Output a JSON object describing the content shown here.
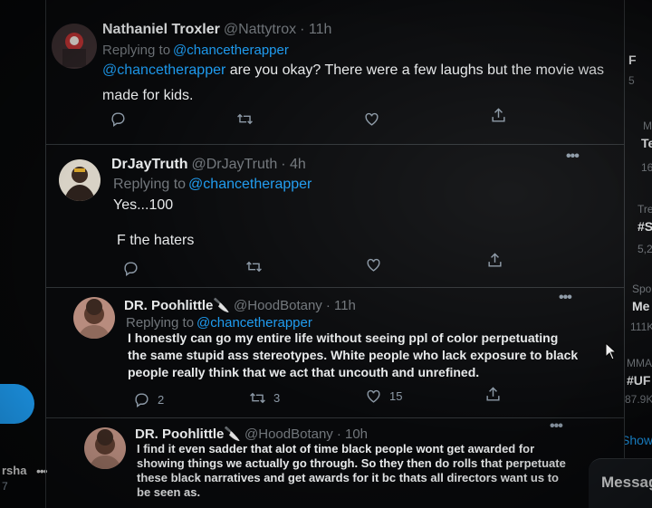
{
  "left_rail": {
    "account_name": "rsha",
    "account_sub": "7",
    "more": "•••"
  },
  "tweets": [
    {
      "display_name": "Nathaniel Troxler",
      "handle": "@Nattytrox",
      "time": "· 11h",
      "replying_to_label": "Replying to",
      "replying_to": "@chancetherapper",
      "mention": "@chancetherapper",
      "text": " are you okay? There were a few laughs but the movie was made for kids.",
      "reply_count": "",
      "retweet_count": "",
      "like_count": ""
    },
    {
      "display_name": "DrJayTruth",
      "handle": "@DrJayTruth",
      "time": "· 4h",
      "replying_to_label": "Replying to",
      "replying_to": "@chancetherapper",
      "text_1": "Yes...100",
      "text_2": "F the haters",
      "more": "•••"
    },
    {
      "display_name": "DR. Poohlittle🔪",
      "handle": "@HoodBotany",
      "time": "· 11h",
      "replying_to_label": "Replying to",
      "replying_to": "@chancetherapper",
      "text": "I honestly can go my entire life without seeing ppl of color perpetuating the same stupid ass stereotypes. White people who lack exposure to black people really think that we act that uncouth and unrefined.",
      "reply_count": "2",
      "retweet_count": "3",
      "like_count": "15",
      "more": "•••"
    },
    {
      "display_name": "DR. Poohlittle🔪",
      "handle": "@HoodBotany",
      "time": "· 10h",
      "text": "I find it even sadder that alot of time black people wont get  awarded for showing things we actually go through. So they then do rolls that perpetuate these black narratives and get awards for it bc thats all directors want us to be seen as.",
      "more": "•••"
    }
  ],
  "sidebar": {
    "items": [
      "F",
      "5",
      "M",
      "Te",
      "16",
      "Tre",
      "#S",
      "5,2",
      "Spo",
      "Me",
      "111K",
      "MMA",
      "#UF",
      "87.9K",
      "Show"
    ],
    "messages": "Messag"
  },
  "colors": {
    "background": "#08090b",
    "accent": "#1d9bf0",
    "text": "#e7e9ea",
    "muted": "#71767b",
    "divider": "#2f3336"
  },
  "icons": [
    "reply-icon",
    "retweet-icon",
    "like-icon",
    "share-icon",
    "more-icon",
    "cursor-icon"
  ]
}
